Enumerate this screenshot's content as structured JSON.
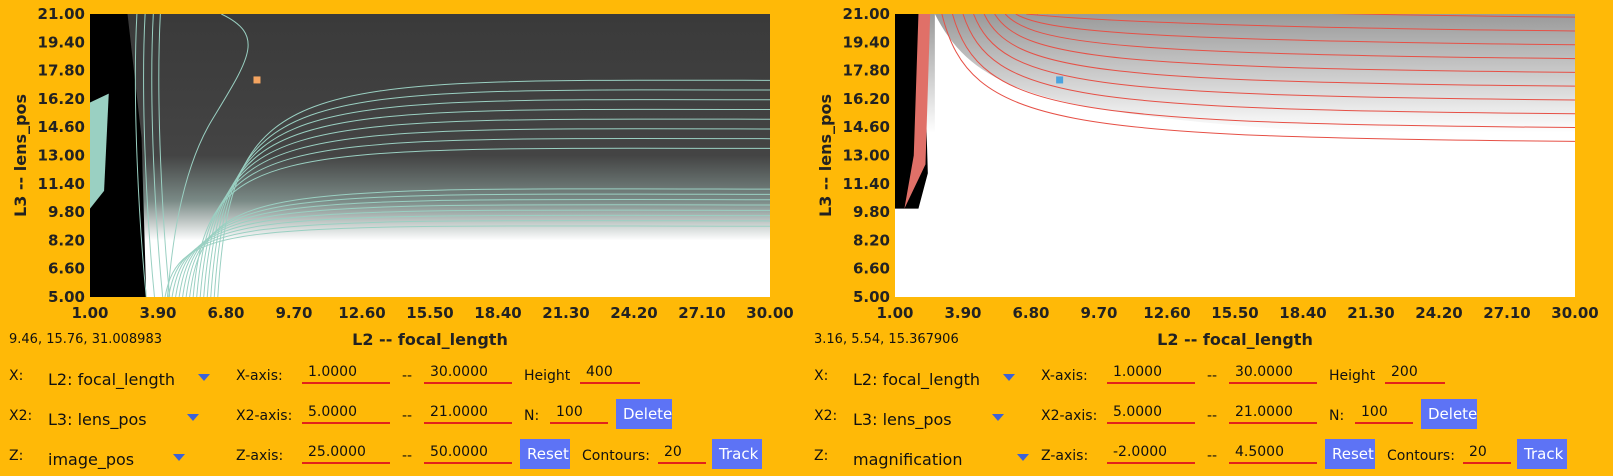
{
  "colors": {
    "background": "#ffb907",
    "button_bg": "#5d73f5",
    "field_underline": "#e2231a",
    "dropdown_arrow": "#3b62d8",
    "left_contour": "#9ad0c2",
    "right_contour": "#e65046",
    "left_marker": "#f4a460",
    "right_marker": "#4aa3df"
  },
  "panels": [
    {
      "chart_data": {
        "type": "heatmap",
        "xlabel": "L2 -- focal_length",
        "ylabel": "L3 -- lens_pos",
        "x_ticks": [
          "1.00",
          "3.90",
          "6.80",
          "9.70",
          "12.60",
          "15.50",
          "18.40",
          "21.30",
          "24.20",
          "27.10",
          "30.00"
        ],
        "y_ticks": [
          "21.00",
          "19.40",
          "17.80",
          "16.20",
          "14.60",
          "13.00",
          "11.40",
          "9.80",
          "8.20",
          "6.60",
          "5.00"
        ],
        "xlim": [
          1,
          30
        ],
        "ylim": [
          5,
          21
        ],
        "zlim": [
          25,
          50
        ],
        "contours": 20,
        "marker": {
          "x": 8.1,
          "y": 17.3
        }
      },
      "readout": "9.46, 15.76, 31.008983",
      "controls": {
        "x_label": "X:",
        "x_select": "L2: focal_length",
        "x2_label": "X2:",
        "x2_select": "L3: lens_pos",
        "z_label": "Z:",
        "z_select": "image_pos",
        "x_axis_label": "X-axis:",
        "x_min": "1.0000",
        "x_max": "30.0000",
        "x2_axis_label": "X2-axis:",
        "x2_min": "5.0000",
        "x2_max": "21.0000",
        "z_axis_label": "Z-axis:",
        "z_min": "25.0000",
        "z_max": "50.0000",
        "range_sep": "--",
        "height_label": "Height",
        "height_value": "400",
        "n_label": "N:",
        "n_value": "100",
        "contours_label": "Contours:",
        "contours_value": "20",
        "delete_button": "Delete",
        "reset_button": "Reset",
        "track_button": "Track"
      }
    },
    {
      "chart_data": {
        "type": "heatmap",
        "xlabel": "L2 -- focal_length",
        "ylabel": "L3 -- lens_pos",
        "x_ticks": [
          "1.00",
          "3.90",
          "6.80",
          "9.70",
          "12.60",
          "15.50",
          "18.40",
          "21.30",
          "24.20",
          "27.10",
          "30.00"
        ],
        "y_ticks": [
          "21.00",
          "19.40",
          "17.80",
          "16.20",
          "14.60",
          "13.00",
          "11.40",
          "9.80",
          "8.20",
          "6.60",
          "5.00"
        ],
        "xlim": [
          1,
          30
        ],
        "ylim": [
          5,
          21
        ],
        "zlim": [
          -2,
          4.5
        ],
        "contours": 20,
        "marker": {
          "x": 8.0,
          "y": 17.3
        }
      },
      "readout": "3.16, 5.54, 15.367906",
      "controls": {
        "x_label": "X:",
        "x_select": "L2: focal_length",
        "x2_label": "X2:",
        "x2_select": "L3: lens_pos",
        "z_label": "Z:",
        "z_select": "magnification",
        "x_axis_label": "X-axis:",
        "x_min": "1.0000",
        "x_max": "30.0000",
        "x2_axis_label": "X2-axis:",
        "x2_min": "5.0000",
        "x2_max": "21.0000",
        "z_axis_label": "Z-axis:",
        "z_min": "-2.0000",
        "z_max": "4.5000",
        "range_sep": "--",
        "height_label": "Height",
        "height_value": "200",
        "n_label": "N:",
        "n_value": "100",
        "contours_label": "Contours:",
        "contours_value": "20",
        "delete_button": "Delete",
        "reset_button": "Reset",
        "track_button": "Track"
      }
    }
  ]
}
